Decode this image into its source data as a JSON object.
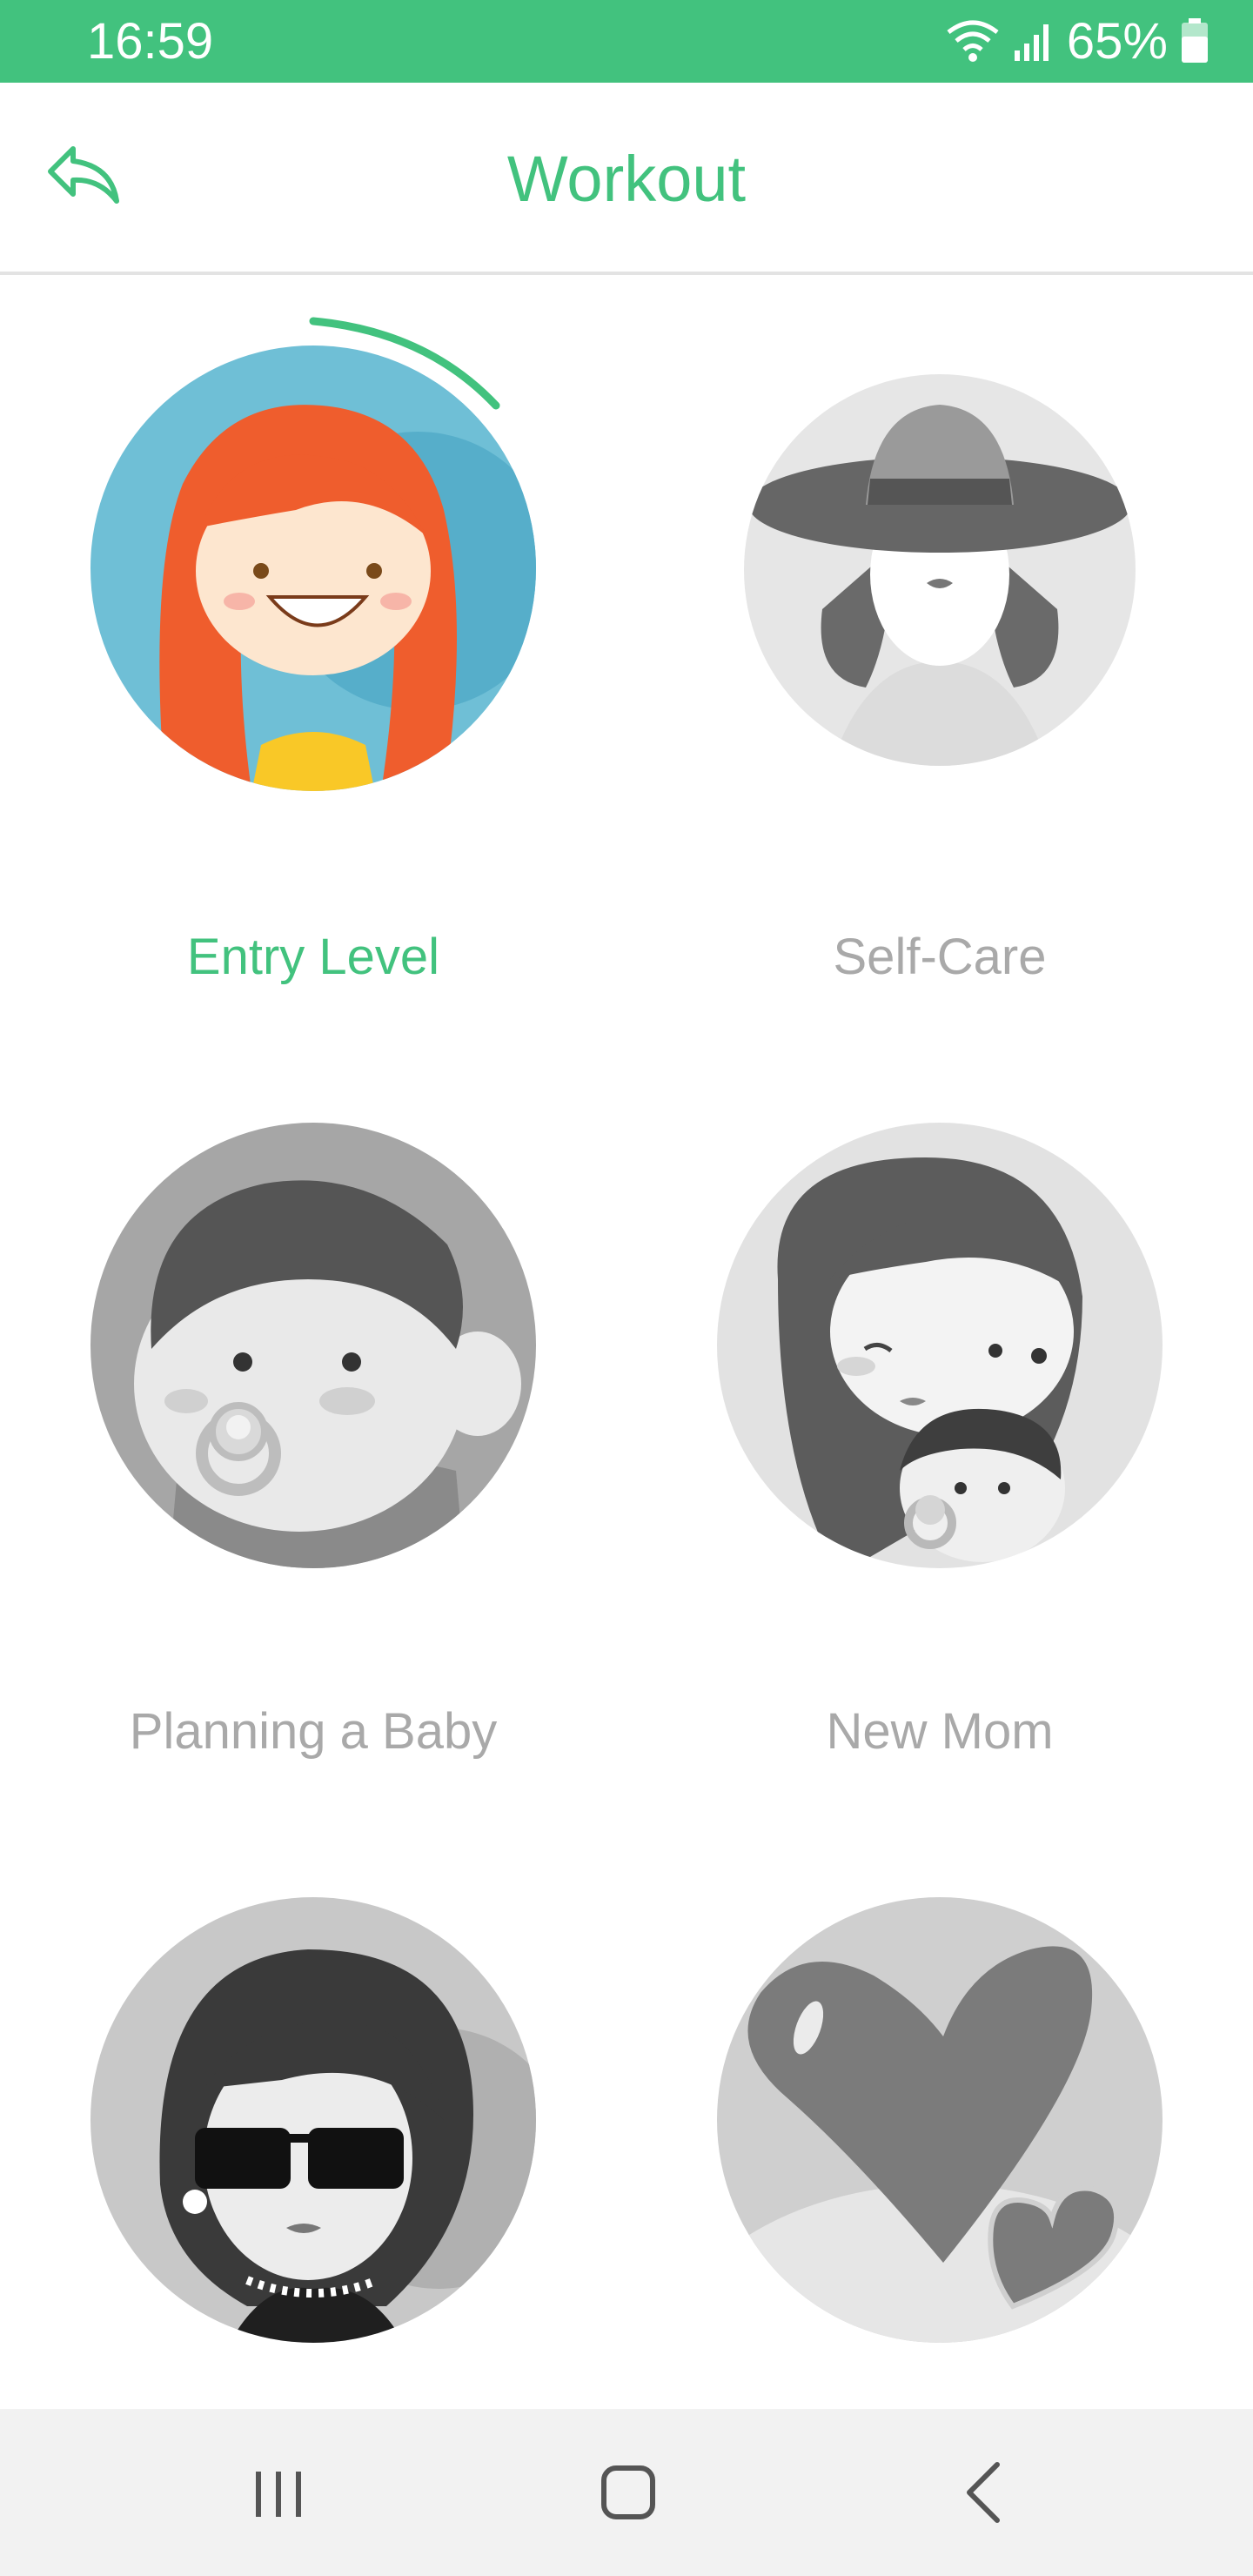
{
  "status_bar": {
    "time": "16:59",
    "battery": "65%",
    "accent_color": "#42c27e"
  },
  "header": {
    "title": "Workout",
    "back_icon": "back-reply-arrow-icon"
  },
  "workouts": [
    {
      "label": "Entry Level",
      "selected": true,
      "icon": "red-haired-girl-avatar"
    },
    {
      "label": "Self-Care",
      "selected": false,
      "icon": "woman-in-sunhat-avatar"
    },
    {
      "label": "Planning a Baby",
      "selected": false,
      "icon": "baby-with-pacifier-avatar"
    },
    {
      "label": "New Mom",
      "selected": false,
      "icon": "mom-with-baby-avatar"
    },
    {
      "label": "",
      "selected": false,
      "icon": "woman-with-sunglasses-avatar"
    },
    {
      "label": "",
      "selected": false,
      "icon": "hearts-avatar"
    }
  ],
  "nav": {
    "recents_icon": "recent-apps-icon",
    "home_icon": "home-icon",
    "back_icon": "back-chevron-icon"
  }
}
